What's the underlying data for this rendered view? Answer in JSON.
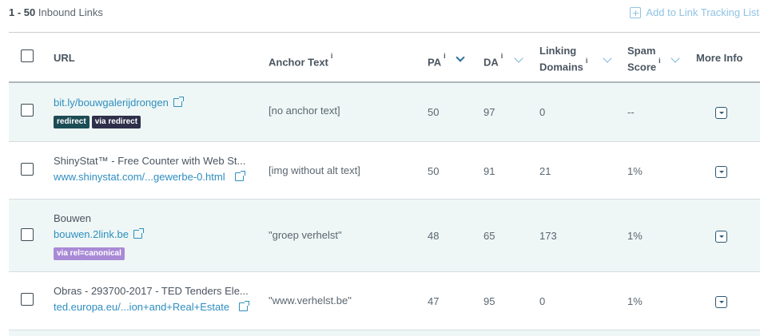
{
  "header": {
    "range": "1 - 50",
    "range_label": "Inbound Links",
    "add_tracking": "Add to Link Tracking List"
  },
  "columns": {
    "url": "URL",
    "anchor": "Anchor Text",
    "pa": "PA",
    "da": "DA",
    "linking_line1": "Linking",
    "linking_line2": "Domains",
    "spam_line1": "Spam",
    "spam_line2": "Score",
    "more": "More Info",
    "info_marker": "i"
  },
  "rows": [
    {
      "title": "",
      "url": "bit.ly/bouwgalerijdrongen",
      "badges": [
        "redirect",
        "via redirect"
      ],
      "anchor": "[no anchor text]",
      "pa": "50",
      "da": "97",
      "linking": "0",
      "spam": "--"
    },
    {
      "title": "ShinyStat™ - Free Counter with Web St...",
      "url": "www.shinystat.com/...gewerbe-0.html",
      "badges": [],
      "anchor": "[img without alt text]",
      "pa": "50",
      "da": "91",
      "linking": "21",
      "spam": "1%"
    },
    {
      "title": "Bouwen",
      "url": "bouwen.2link.be",
      "badges": [
        "via rel=canonical"
      ],
      "anchor": "\"groep verhelst\"",
      "pa": "48",
      "da": "65",
      "linking": "173",
      "spam": "1%"
    },
    {
      "title": "Obras - 293700-2017 - TED Tenders Ele...",
      "url": "ted.europa.eu/...ion+and+Real+Estate",
      "badges": [],
      "anchor": "\"www.verhelst.be\"",
      "pa": "47",
      "da": "95",
      "linking": "0",
      "spam": "1%"
    }
  ],
  "colors": {
    "link": "#2f8ec0",
    "row_shade": "#eef7f5",
    "badge_redirect": "#1c4c55",
    "badge_via_redirect": "#2e2f4a",
    "badge_canonical": "#a98ad6",
    "sort_active": "#2b6f9a"
  }
}
